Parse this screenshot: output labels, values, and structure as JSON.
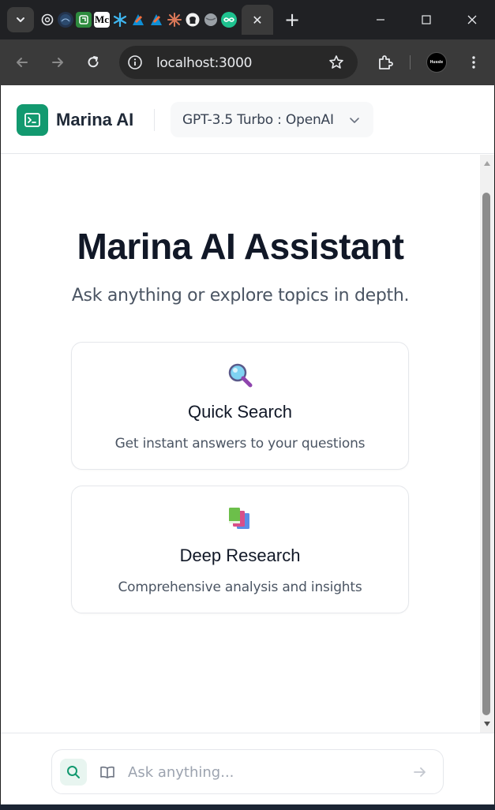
{
  "browser": {
    "address": "localhost:3000",
    "active_tab_close": "✕",
    "new_tab": "+",
    "pinned_tabs": [
      "chatgpt-favicon",
      "globe-favicon",
      "green-favicon",
      "medium-favicon",
      "snowflake-favicon",
      "fluttering-favicon",
      "fluttering-favicon-2",
      "claude-favicon",
      "github-favicon",
      "globe-favicon-2",
      "infinity-favicon"
    ],
    "medium_label": "Mc",
    "profile_text": "Hussle"
  },
  "app": {
    "brand": "Marina AI",
    "model": "GPT-3.5 Turbo : OpenAI",
    "accent_color": "#12996f"
  },
  "hero": {
    "title": "Marina AI Assistant",
    "subtitle": "Ask anything or explore topics in depth."
  },
  "cards": [
    {
      "icon": "magnifier-emoji-icon",
      "title": "Quick Search",
      "description": "Get instant answers to your questions"
    },
    {
      "icon": "books-emoji-icon",
      "title": "Deep Research",
      "description": "Comprehensive analysis and insights"
    }
  ],
  "chat": {
    "placeholder": "Ask anything...",
    "value": ""
  }
}
